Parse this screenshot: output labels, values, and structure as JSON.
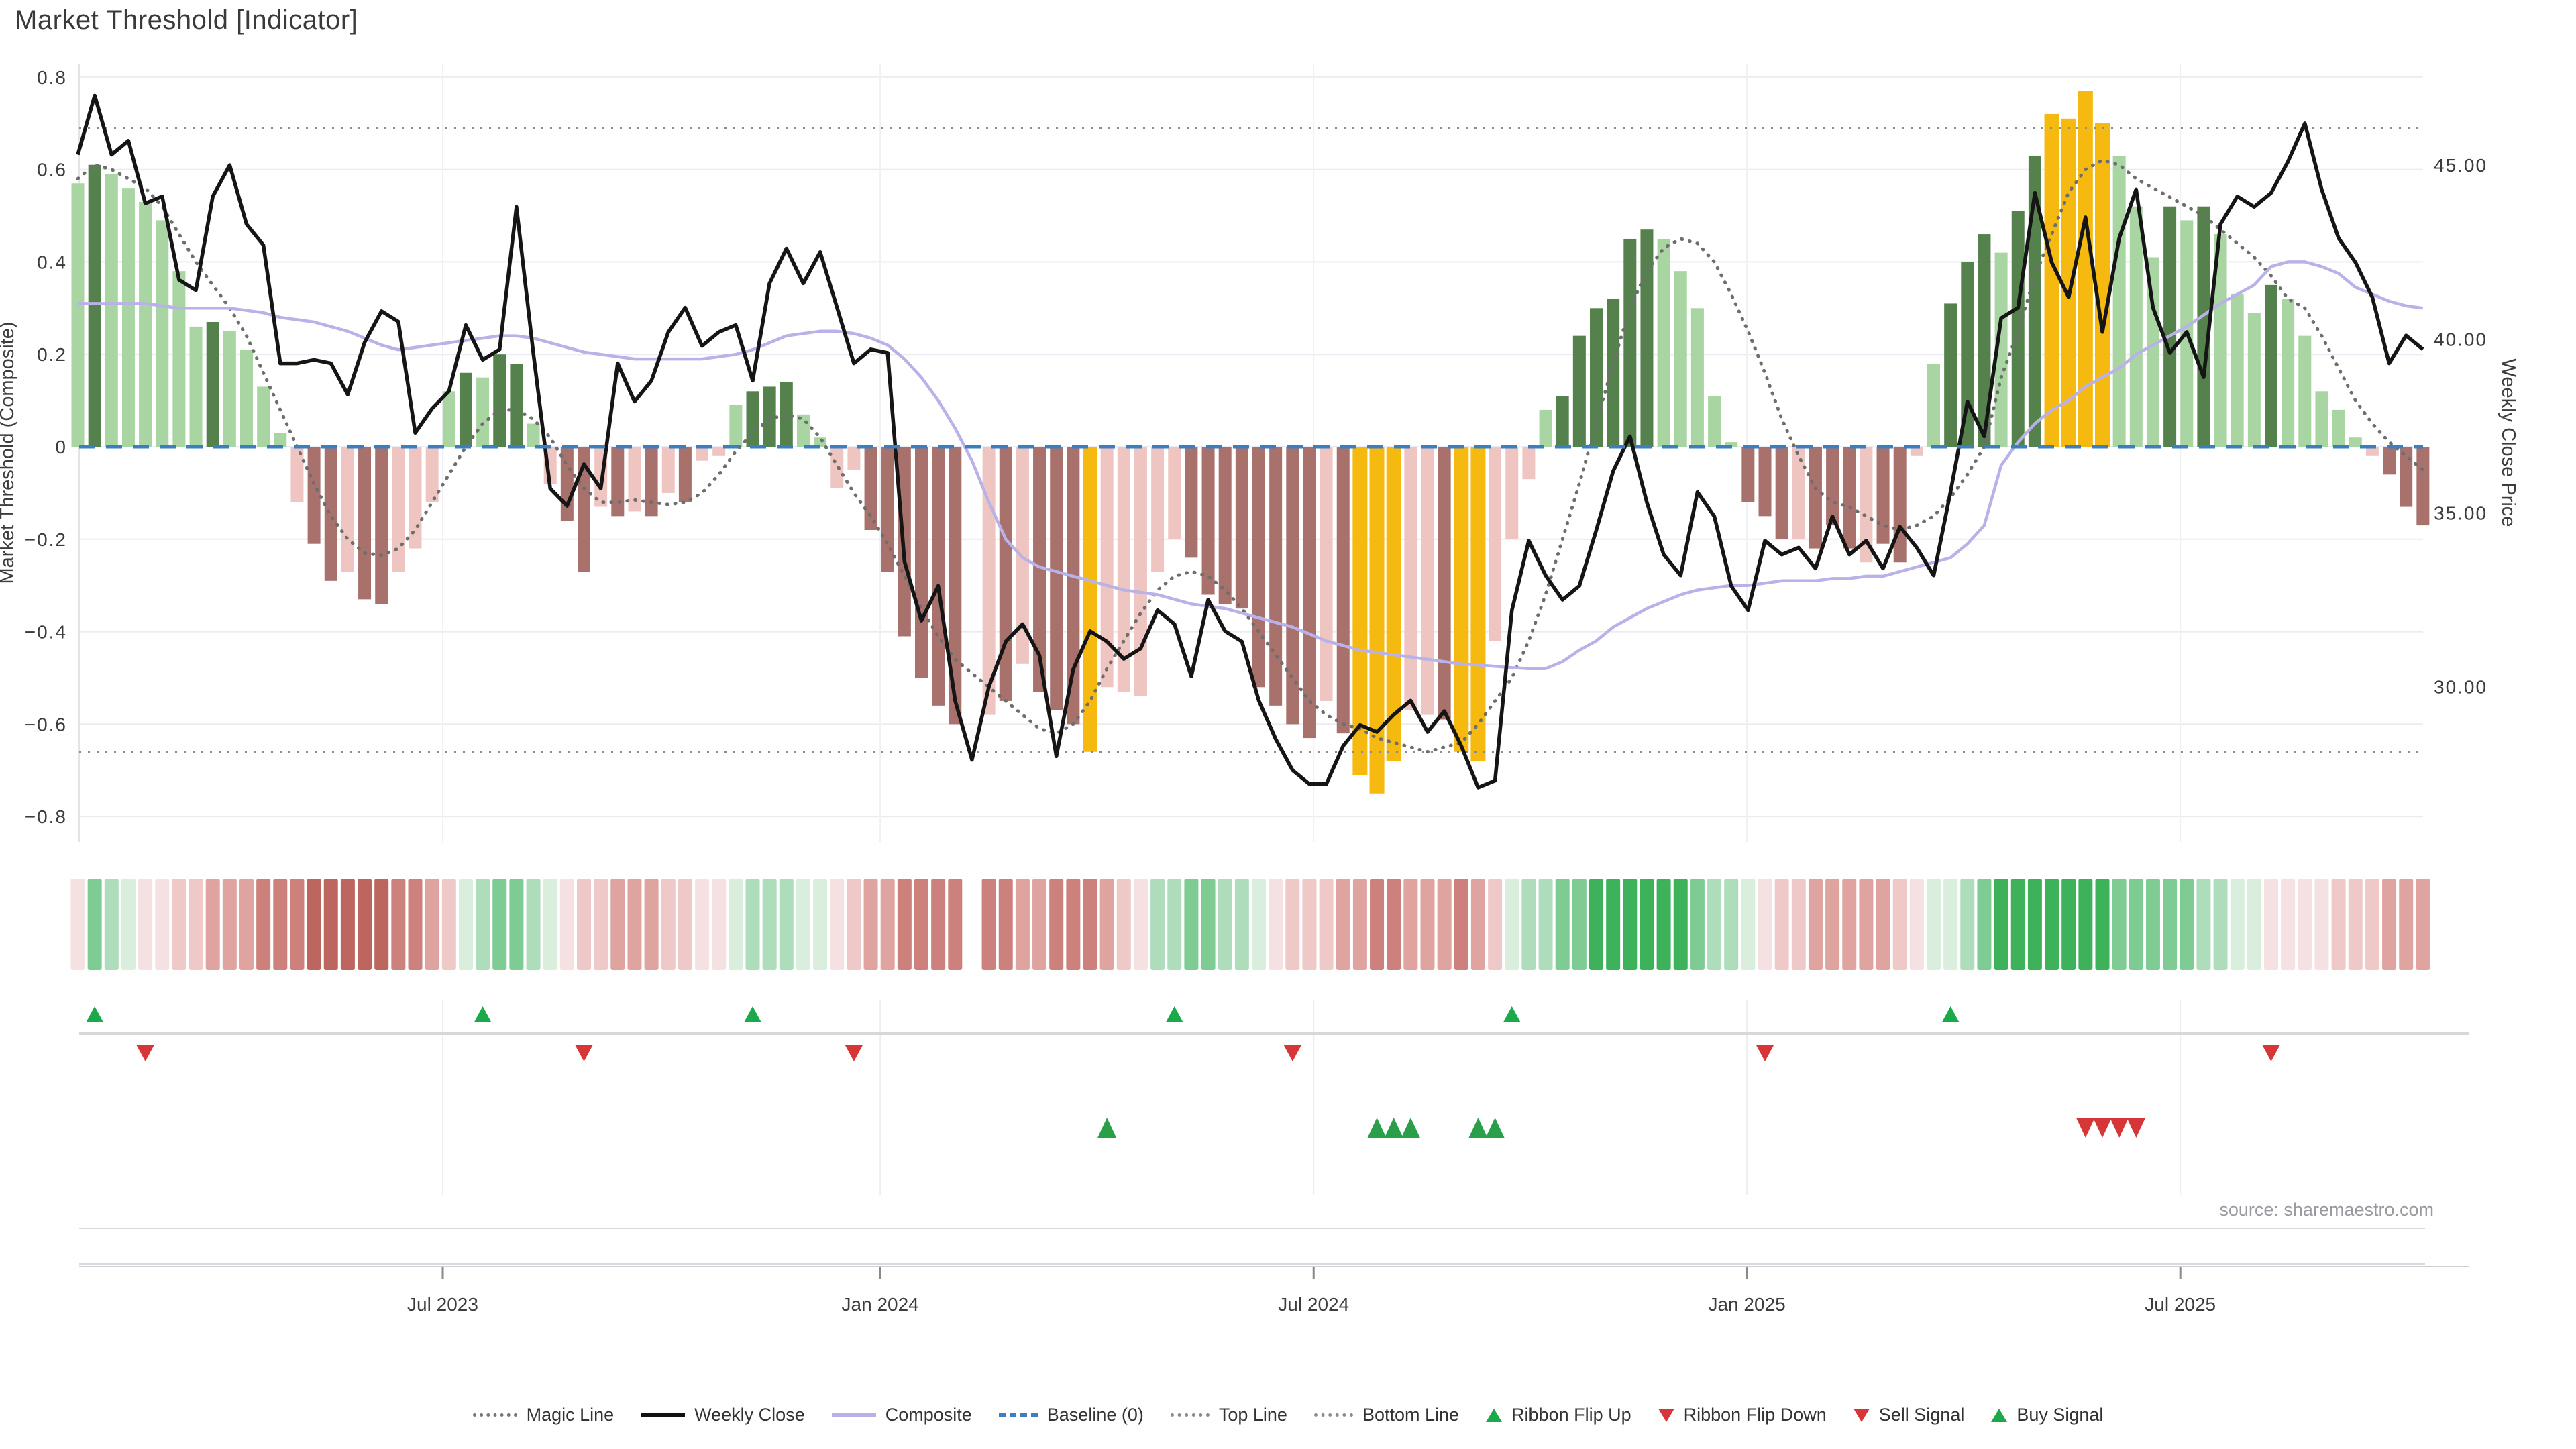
{
  "title": "Market Threshold [Indicator]",
  "source": "source: sharemaestro.com",
  "legend": {
    "items": [
      {
        "label": "Magic Line",
        "icon": "dotted-gray-line"
      },
      {
        "label": "Weekly Close",
        "icon": "solid-black-line"
      },
      {
        "label": "Composite",
        "icon": "solid-purple-line"
      },
      {
        "label": "Baseline (0)",
        "icon": "dashed-blue-line"
      },
      {
        "label": "Top Line",
        "icon": "dotted-gray-line"
      },
      {
        "label": "Bottom Line",
        "icon": "dotted-gray-line"
      },
      {
        "label": "Ribbon Flip Up",
        "icon": "green-up-triangle"
      },
      {
        "label": "Ribbon Flip Down",
        "icon": "red-down-triangle"
      },
      {
        "label": "Sell Signal",
        "icon": "red-down-triangle"
      },
      {
        "label": "Buy Signal",
        "icon": "green-up-triangle"
      }
    ]
  },
  "chart_data": {
    "type": "bar",
    "subtype": "composite-threshold-indicator",
    "title": "Market Threshold [Indicator]",
    "y_left": {
      "label": "Market Threshold (Composite)",
      "tick_labels": [
        "0.8",
        "0.6",
        "0.4",
        "0.2",
        "0",
        "−0.2",
        "−0.4",
        "−0.6",
        "−0.8"
      ],
      "tick_values": [
        0.8,
        0.6,
        0.4,
        0.2,
        0,
        -0.2,
        -0.4,
        -0.6,
        -0.8
      ],
      "range": [
        -0.9,
        0.9
      ]
    },
    "y_right": {
      "label": "Weekly Close Price",
      "tick_labels": [
        "45.00",
        "40.00",
        "35.00",
        "30.00"
      ],
      "tick_values": [
        45,
        40,
        35,
        30
      ]
    },
    "x": {
      "tick_labels": [
        "Jul 2023",
        "Jan 2024",
        "Jul 2024",
        "Jan 2025",
        "Jul 2025"
      ],
      "tick_weeks": [
        22.63,
        48.56,
        74.25,
        99.93,
        125.62
      ],
      "weeks_total": 140,
      "missing_week": 54
    },
    "reference_lines": {
      "baseline": 0,
      "top_line": 0.69,
      "bottom_line": -0.66
    },
    "bars": [
      [
        0.57,
        "L"
      ],
      [
        0.61,
        "D"
      ],
      [
        0.59,
        "L"
      ],
      [
        0.56,
        "L"
      ],
      [
        0.53,
        "L"
      ],
      [
        0.49,
        "L"
      ],
      [
        0.38,
        "L"
      ],
      [
        0.26,
        "L"
      ],
      [
        0.27,
        "D"
      ],
      [
        0.25,
        "L"
      ],
      [
        0.21,
        "L"
      ],
      [
        0.13,
        "L"
      ],
      [
        0.03,
        "L"
      ],
      [
        -0.12,
        "p"
      ],
      [
        -0.21,
        "d"
      ],
      [
        -0.29,
        "d"
      ],
      [
        -0.27,
        "p"
      ],
      [
        -0.33,
        "d"
      ],
      [
        -0.34,
        "d"
      ],
      [
        -0.27,
        "p"
      ],
      [
        -0.22,
        "p"
      ],
      [
        -0.12,
        "p"
      ],
      [
        0.12,
        "L"
      ],
      [
        0.16,
        "D"
      ],
      [
        0.15,
        "L"
      ],
      [
        0.2,
        "D"
      ],
      [
        0.18,
        "D"
      ],
      [
        0.05,
        "L"
      ],
      [
        -0.08,
        "p"
      ],
      [
        -0.16,
        "d"
      ],
      [
        -0.27,
        "d"
      ],
      [
        -0.13,
        "p"
      ],
      [
        -0.15,
        "d"
      ],
      [
        -0.14,
        "p"
      ],
      [
        -0.15,
        "d"
      ],
      [
        -0.1,
        "p"
      ],
      [
        -0.12,
        "d"
      ],
      [
        -0.03,
        "p"
      ],
      [
        -0.02,
        "p"
      ],
      [
        0.09,
        "L"
      ],
      [
        0.12,
        "D"
      ],
      [
        0.13,
        "D"
      ],
      [
        0.14,
        "D"
      ],
      [
        0.07,
        "L"
      ],
      [
        0.02,
        "L"
      ],
      [
        -0.09,
        "p"
      ],
      [
        -0.05,
        "p"
      ],
      [
        -0.18,
        "d"
      ],
      [
        -0.27,
        "d"
      ],
      [
        -0.41,
        "d"
      ],
      [
        -0.5,
        "d"
      ],
      [
        -0.56,
        "d"
      ],
      [
        -0.6,
        "d"
      ],
      null,
      [
        -0.58,
        "p"
      ],
      [
        -0.55,
        "d"
      ],
      [
        -0.47,
        "p"
      ],
      [
        -0.53,
        "d"
      ],
      [
        -0.57,
        "d"
      ],
      [
        -0.6,
        "d"
      ],
      [
        -0.66,
        "G"
      ],
      [
        -0.52,
        "p"
      ],
      [
        -0.53,
        "p"
      ],
      [
        -0.54,
        "p"
      ],
      [
        -0.27,
        "p"
      ],
      [
        -0.2,
        "p"
      ],
      [
        -0.24,
        "d"
      ],
      [
        -0.32,
        "d"
      ],
      [
        -0.34,
        "d"
      ],
      [
        -0.35,
        "d"
      ],
      [
        -0.52,
        "d"
      ],
      [
        -0.56,
        "d"
      ],
      [
        -0.6,
        "d"
      ],
      [
        -0.63,
        "d"
      ],
      [
        -0.55,
        "p"
      ],
      [
        -0.62,
        "d"
      ],
      [
        -0.71,
        "G"
      ],
      [
        -0.75,
        "G"
      ],
      [
        -0.68,
        "G"
      ],
      [
        -0.57,
        "p"
      ],
      [
        -0.58,
        "p"
      ],
      [
        -0.59,
        "d"
      ],
      [
        -0.66,
        "G"
      ],
      [
        -0.68,
        "G"
      ],
      [
        -0.42,
        "p"
      ],
      [
        -0.2,
        "p"
      ],
      [
        -0.07,
        "p"
      ],
      [
        0.08,
        "L"
      ],
      [
        0.11,
        "D"
      ],
      [
        0.24,
        "D"
      ],
      [
        0.3,
        "D"
      ],
      [
        0.32,
        "D"
      ],
      [
        0.45,
        "D"
      ],
      [
        0.47,
        "D"
      ],
      [
        0.45,
        "L"
      ],
      [
        0.38,
        "L"
      ],
      [
        0.3,
        "L"
      ],
      [
        0.11,
        "L"
      ],
      [
        0.01,
        "L"
      ],
      [
        -0.12,
        "d"
      ],
      [
        -0.15,
        "d"
      ],
      [
        -0.2,
        "d"
      ],
      [
        -0.2,
        "p"
      ],
      [
        -0.22,
        "d"
      ],
      [
        -0.17,
        "d"
      ],
      [
        -0.22,
        "d"
      ],
      [
        -0.25,
        "p"
      ],
      [
        -0.21,
        "d"
      ],
      [
        -0.25,
        "d"
      ],
      [
        -0.02,
        "p"
      ],
      [
        0.18,
        "L"
      ],
      [
        0.31,
        "D"
      ],
      [
        0.4,
        "D"
      ],
      [
        0.46,
        "D"
      ],
      [
        0.42,
        "L"
      ],
      [
        0.51,
        "D"
      ],
      [
        0.63,
        "D"
      ],
      [
        0.72,
        "G"
      ],
      [
        0.71,
        "G"
      ],
      [
        0.77,
        "G"
      ],
      [
        0.7,
        "G"
      ],
      [
        0.63,
        "L"
      ],
      [
        0.52,
        "L"
      ],
      [
        0.41,
        "L"
      ],
      [
        0.52,
        "D"
      ],
      [
        0.49,
        "L"
      ],
      [
        0.52,
        "D"
      ],
      [
        0.46,
        "L"
      ],
      [
        0.33,
        "L"
      ],
      [
        0.29,
        "L"
      ],
      [
        0.35,
        "D"
      ],
      [
        0.32,
        "L"
      ],
      [
        0.24,
        "L"
      ],
      [
        0.12,
        "L"
      ],
      [
        0.08,
        "L"
      ],
      [
        0.02,
        "L"
      ],
      [
        -0.02,
        "p"
      ],
      [
        -0.06,
        "d"
      ],
      [
        -0.13,
        "d"
      ],
      [
        -0.17,
        "d"
      ]
    ],
    "ribbon": [
      "r1",
      "g3",
      "g2",
      "g1",
      "r1",
      "r1",
      "r2",
      "r2",
      "r3",
      "r3",
      "r3",
      "r4",
      "r4",
      "r4",
      "r5",
      "r5",
      "r5",
      "r5",
      "r5",
      "r4",
      "r4",
      "r3",
      "r2",
      "g1",
      "g2",
      "g3",
      "g3",
      "g2",
      "g1",
      "r1",
      "r2",
      "r2",
      "r3",
      "r3",
      "r3",
      "r2",
      "r2",
      "r1",
      "r1",
      "g1",
      "g2",
      "g2",
      "g2",
      "g1",
      "g1",
      "r1",
      "r2",
      "r3",
      "r3",
      "r4",
      "r4",
      "r4",
      "r4",
      null,
      "r4",
      "r4",
      "r3",
      "r3",
      "r4",
      "r4",
      "r4",
      "r3",
      "r2",
      "r1",
      "g2",
      "g2",
      "g3",
      "g3",
      "g2",
      "g2",
      "g1",
      "r1",
      "r2",
      "r2",
      "r2",
      "r3",
      "r3",
      "r4",
      "r4",
      "r3",
      "r3",
      "r3",
      "r4",
      "r3",
      "r2",
      "g1",
      "g2",
      "g2",
      "g3",
      "g3",
      "g4",
      "g4",
      "g4",
      "g4",
      "g4",
      "g4",
      "g3",
      "g2",
      "g2",
      "g1",
      "r1",
      "r2",
      "r2",
      "r3",
      "r3",
      "r3",
      "r3",
      "r3",
      "r2",
      "r1",
      "g1",
      "g1",
      "g2",
      "g3",
      "g4",
      "g4",
      "g4",
      "g4",
      "g4",
      "g4",
      "g4",
      "g3",
      "g3",
      "g3",
      "g3",
      "g3",
      "g2",
      "g2",
      "g1",
      "g1",
      "r1",
      "r1",
      "r1",
      "r1",
      "r2",
      "r2",
      "r2",
      "r3",
      "r3",
      "r3"
    ],
    "close": [
      45.3,
      47.0,
      45.3,
      45.7,
      43.9,
      44.1,
      41.7,
      41.4,
      44.1,
      45.0,
      43.3,
      42.7,
      39.3,
      39.3,
      39.4,
      39.3,
      38.4,
      39.9,
      40.8,
      40.5,
      37.3,
      38.0,
      38.5,
      40.4,
      39.4,
      39.7,
      43.8,
      39.6,
      35.7,
      35.2,
      36.4,
      35.7,
      39.3,
      38.2,
      38.8,
      40.2,
      40.9,
      39.8,
      40.2,
      40.4,
      38.8,
      41.6,
      42.6,
      41.6,
      42.5,
      40.9,
      39.3,
      39.7,
      39.6,
      33.6,
      31.9,
      32.9,
      29.6,
      27.9,
      30.0,
      31.3,
      31.8,
      30.9,
      28.0,
      30.5,
      31.6,
      31.3,
      30.8,
      31.1,
      32.2,
      31.8,
      30.3,
      32.5,
      31.6,
      31.3,
      29.6,
      28.5,
      27.6,
      27.2,
      27.2,
      28.3,
      28.9,
      28.7,
      29.2,
      29.6,
      28.7,
      29.3,
      28.3,
      27.1,
      27.3,
      32.2,
      34.2,
      33.2,
      32.5,
      32.9,
      34.5,
      36.2,
      37.2,
      35.3,
      33.8,
      33.2,
      35.6,
      34.9,
      32.9,
      32.2,
      34.2,
      33.8,
      34.0,
      33.4,
      34.9,
      33.8,
      34.2,
      33.4,
      34.6,
      34.0,
      33.2,
      35.6,
      38.2,
      37.2,
      40.6,
      40.9,
      44.2,
      42.2,
      41.2,
      43.5,
      40.2,
      42.9,
      44.3,
      40.9,
      39.6,
      40.2,
      38.9,
      43.3,
      44.1,
      43.8,
      44.2,
      45.1,
      46.2,
      44.3,
      42.9,
      42.2,
      41.2,
      39.3,
      40.1,
      39.7
    ],
    "composite": [
      0.31,
      0.31,
      0.31,
      0.31,
      0.31,
      0.305,
      0.3,
      0.3,
      0.3,
      0.3,
      0.295,
      0.29,
      0.28,
      0.275,
      0.27,
      0.26,
      0.25,
      0.235,
      0.22,
      0.21,
      0.215,
      0.22,
      0.225,
      0.23,
      0.235,
      0.24,
      0.24,
      0.235,
      0.225,
      0.215,
      0.205,
      0.2,
      0.195,
      0.19,
      0.19,
      0.19,
      0.19,
      0.19,
      0.195,
      0.2,
      0.21,
      0.225,
      0.24,
      0.245,
      0.25,
      0.25,
      0.245,
      0.235,
      0.22,
      0.19,
      0.15,
      0.1,
      0.04,
      -0.03,
      -0.12,
      -0.2,
      -0.24,
      -0.26,
      -0.27,
      -0.28,
      -0.29,
      -0.3,
      -0.31,
      -0.315,
      -0.32,
      -0.33,
      -0.34,
      -0.345,
      -0.35,
      -0.36,
      -0.37,
      -0.38,
      -0.39,
      -0.405,
      -0.42,
      -0.43,
      -0.44,
      -0.445,
      -0.45,
      -0.455,
      -0.46,
      -0.465,
      -0.47,
      -0.472,
      -0.475,
      -0.478,
      -0.48,
      -0.48,
      -0.465,
      -0.44,
      -0.42,
      -0.39,
      -0.37,
      -0.35,
      -0.335,
      -0.32,
      -0.31,
      -0.305,
      -0.3,
      -0.3,
      -0.295,
      -0.29,
      -0.29,
      -0.29,
      -0.285,
      -0.285,
      -0.28,
      -0.28,
      -0.27,
      -0.26,
      -0.25,
      -0.24,
      -0.21,
      -0.17,
      -0.04,
      0.01,
      0.05,
      0.08,
      0.1,
      0.13,
      0.15,
      0.17,
      0.2,
      0.22,
      0.24,
      0.26,
      0.285,
      0.31,
      0.33,
      0.35,
      0.39,
      0.4,
      0.4,
      0.39,
      0.375,
      0.345,
      0.33,
      0.315,
      0.305,
      0.3
    ],
    "magic": [
      0.58,
      0.61,
      0.6,
      0.58,
      0.56,
      0.52,
      0.46,
      0.4,
      0.35,
      0.3,
      0.24,
      0.16,
      0.08,
      0.0,
      -0.08,
      -0.15,
      -0.2,
      -0.23,
      -0.235,
      -0.22,
      -0.18,
      -0.12,
      -0.06,
      0.0,
      0.05,
      0.08,
      0.08,
      0.06,
      0.02,
      -0.04,
      -0.09,
      -0.12,
      -0.12,
      -0.115,
      -0.12,
      -0.125,
      -0.12,
      -0.1,
      -0.06,
      -0.01,
      0.03,
      0.06,
      0.07,
      0.06,
      0.02,
      -0.04,
      -0.1,
      -0.15,
      -0.21,
      -0.28,
      -0.35,
      -0.41,
      -0.46,
      -0.49,
      -0.52,
      -0.55,
      -0.58,
      -0.61,
      -0.62,
      -0.6,
      -0.55,
      -0.48,
      -0.42,
      -0.36,
      -0.31,
      -0.28,
      -0.27,
      -0.28,
      -0.31,
      -0.35,
      -0.4,
      -0.45,
      -0.5,
      -0.55,
      -0.58,
      -0.6,
      -0.61,
      -0.63,
      -0.64,
      -0.65,
      -0.66,
      -0.65,
      -0.64,
      -0.6,
      -0.55,
      -0.5,
      -0.42,
      -0.32,
      -0.2,
      -0.08,
      0.05,
      0.18,
      0.3,
      0.38,
      0.43,
      0.45,
      0.44,
      0.4,
      0.33,
      0.25,
      0.16,
      0.06,
      -0.02,
      -0.09,
      -0.12,
      -0.13,
      -0.15,
      -0.17,
      -0.18,
      -0.17,
      -0.15,
      -0.11,
      -0.06,
      0.0,
      0.15,
      0.25,
      0.37,
      0.46,
      0.55,
      0.6,
      0.62,
      0.61,
      0.58,
      0.56,
      0.54,
      0.52,
      0.5,
      0.47,
      0.44,
      0.41,
      0.37,
      0.32,
      0.3,
      0.24,
      0.17,
      0.1,
      0.05,
      0.01,
      -0.02,
      -0.05
    ],
    "signals": {
      "ribbon_flip_up_weeks": [
        2,
        25,
        41,
        66,
        86,
        112
      ],
      "ribbon_flip_down_weeks": [
        5,
        31,
        47,
        73,
        101,
        131
      ],
      "buy_weeks": [
        62,
        78,
        79,
        80,
        84,
        85
      ],
      "sell_weeks": [
        120,
        121,
        122,
        123
      ]
    },
    "palette": {
      "bar_light_green": "#a8d5a2",
      "bar_dark_green": "#55824c",
      "bar_gold": "#f5b90f",
      "bar_pink": "#efc5c2",
      "bar_dark_red": "#a8716c",
      "ribbon_reds": [
        "#f5e1e1",
        "#eec9c8",
        "#dfa3a0",
        "#cd817c",
        "#bd6660"
      ],
      "ribbon_greens": [
        "#d9eedd",
        "#aeddbb",
        "#7ecb94",
        "#3eb25a"
      ],
      "composite_line": "#b9b2e8",
      "close_line": "#151515",
      "magic_line": "#6e6e6e",
      "baseline": "#3b7fc0",
      "threshold_line": "#8c8c8c",
      "flip_up": "#1ba94c",
      "flip_down": "#d63638",
      "buy": "#2b9e4a",
      "sell": "#d63638"
    },
    "grid": true,
    "legend_position": "bottom"
  }
}
